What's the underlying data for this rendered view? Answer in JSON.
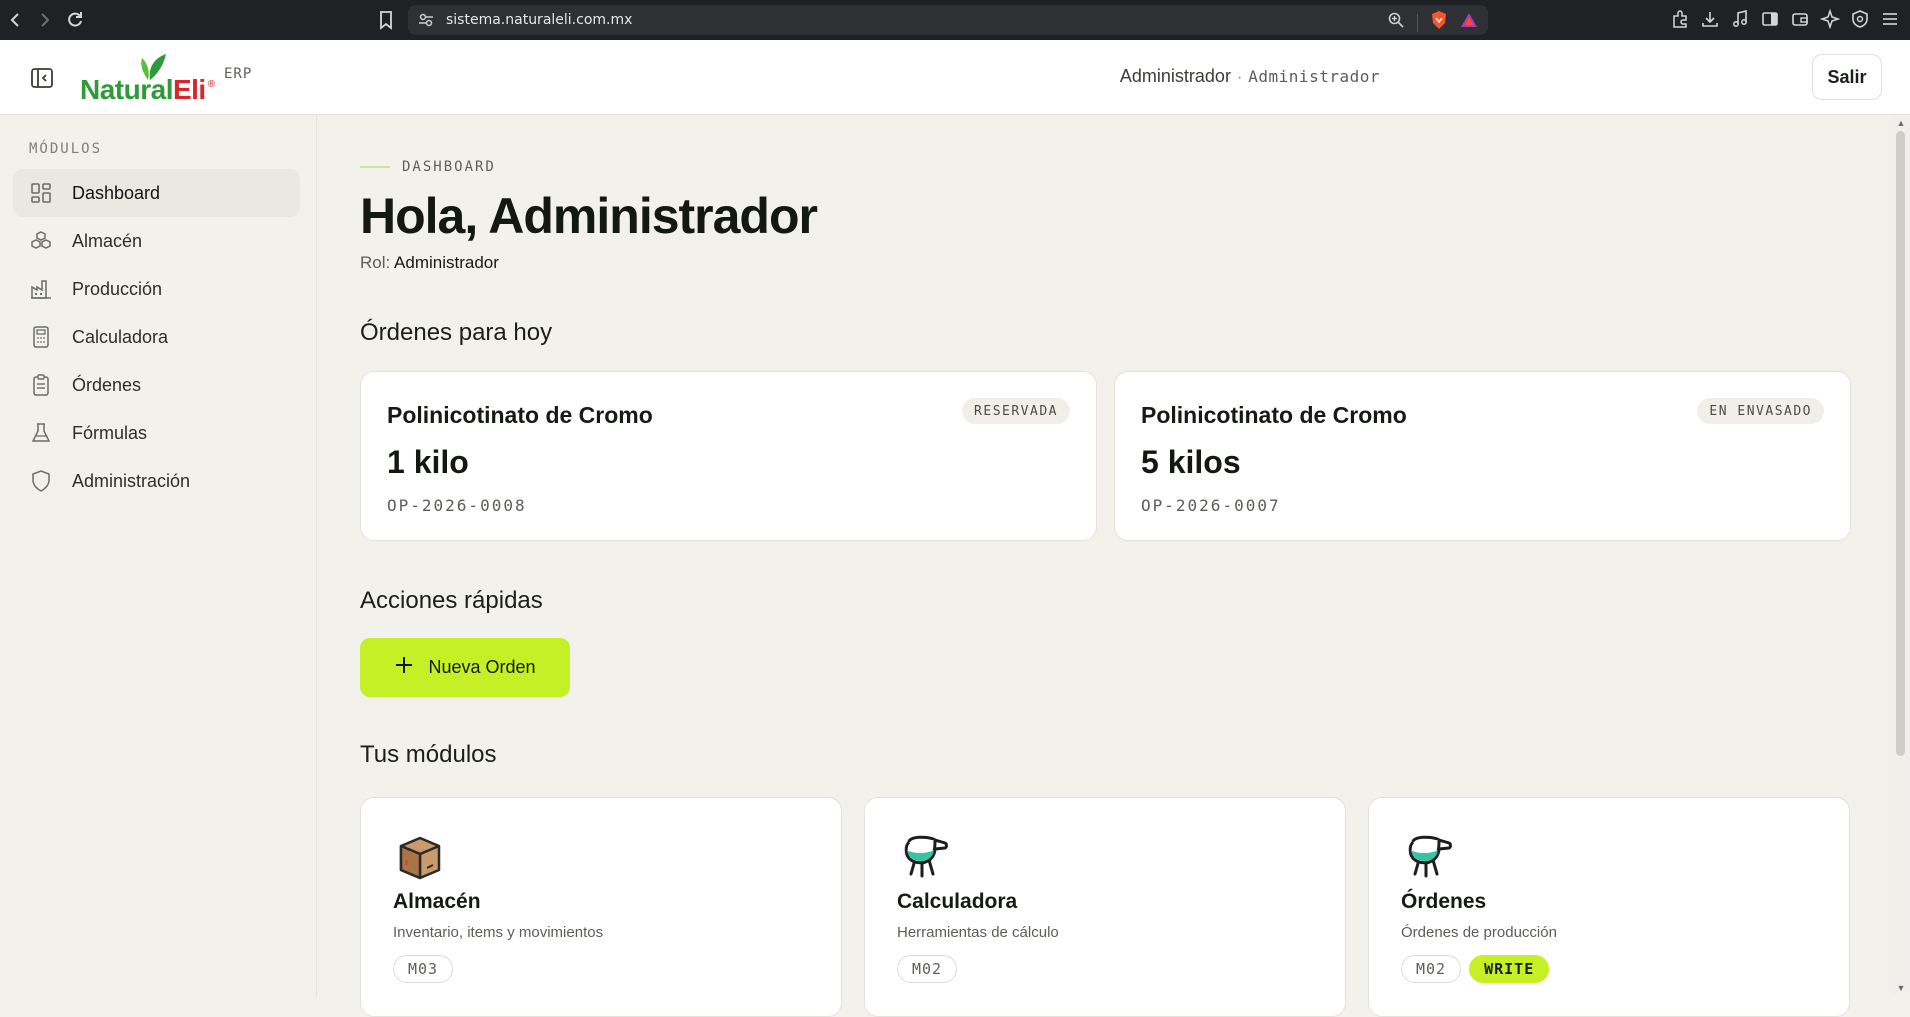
{
  "browser": {
    "url": "sistema.naturaleli.com.mx"
  },
  "header": {
    "logo_text_a": "Natural",
    "logo_text_b": "Eli",
    "logo_reg": "®",
    "erp": "ERP",
    "user_name": "Administrador",
    "user_separator": "·",
    "user_role": "Administrador",
    "logout": "Salir"
  },
  "sidebar": {
    "title": "MÓDULOS",
    "items": [
      {
        "label": "Dashboard",
        "icon": "dashboard-icon"
      },
      {
        "label": "Almacén",
        "icon": "boxes-icon"
      },
      {
        "label": "Producción",
        "icon": "factory-icon"
      },
      {
        "label": "Calculadora",
        "icon": "calculator-icon"
      },
      {
        "label": "Órdenes",
        "icon": "clipboard-icon"
      },
      {
        "label": "Fórmulas",
        "icon": "flask-icon"
      },
      {
        "label": "Administración",
        "icon": "shield-icon"
      }
    ]
  },
  "main": {
    "eyebrow": "DASHBOARD",
    "greeting": "Hola, Administrador",
    "role_label": "Rol:",
    "role_value": "Administrador",
    "orders_title": "Órdenes para hoy",
    "orders": [
      {
        "name": "Polinicotinato de Cromo",
        "qty": "1 kilo",
        "code": "OP-2026-0008",
        "status": "RESERVADA"
      },
      {
        "name": "Polinicotinato de Cromo",
        "qty": "5 kilos",
        "code": "OP-2026-0007",
        "status": "EN ENVASADO"
      }
    ],
    "quick_title": "Acciones rápidas",
    "new_order": "Nueva Orden",
    "modules_title": "Tus módulos",
    "modules": [
      {
        "name": "Almacén",
        "desc": "Inventario, items y movimientos",
        "tag": "M03",
        "icon": "package-icon"
      },
      {
        "name": "Calculadora",
        "desc": "Herramientas de cálculo",
        "tag": "M02",
        "icon": "flask-drop-icon"
      },
      {
        "name": "Órdenes",
        "desc": "Órdenes de producción",
        "tag": "M02",
        "perm": "WRITE",
        "icon": "flask-drop-icon"
      }
    ]
  },
  "colors": {
    "accent": "#c5f026",
    "background": "#f3f1ec",
    "brand_green": "#2f9a3a",
    "brand_red": "#d8262b"
  }
}
